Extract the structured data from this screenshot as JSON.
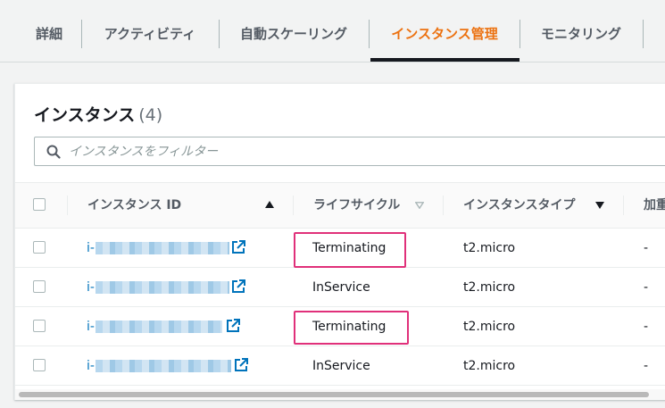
{
  "tabs": [
    {
      "label": "詳細",
      "active": false
    },
    {
      "label": "アクティビティ",
      "active": false
    },
    {
      "label": "自動スケーリング",
      "active": false
    },
    {
      "label": "インスタンス管理",
      "active": true
    },
    {
      "label": "モニタリング",
      "active": false
    }
  ],
  "colors": {
    "accent": "#ec7211",
    "link": "#0073bb",
    "highlight": "#e0307a"
  },
  "panel": {
    "title": "インスタンス",
    "count": "(4)",
    "search_placeholder": "インスタンスをフィルター"
  },
  "table": {
    "columns": [
      "インスタンス ID",
      "ライフサイクル",
      "インスタンスタイプ",
      "加重"
    ],
    "rows": [
      {
        "id_prefix": "i-",
        "lifecycle": "Terminating",
        "type": "t2.micro",
        "weight": "-",
        "highlighted": true
      },
      {
        "id_prefix": "i-",
        "lifecycle": "InService",
        "type": "t2.micro",
        "weight": "-",
        "highlighted": false
      },
      {
        "id_prefix": "i-",
        "lifecycle": "Terminating",
        "type": "t2.micro",
        "weight": "-",
        "highlighted": true
      },
      {
        "id_prefix": "i-",
        "lifecycle": "InService",
        "type": "t2.micro",
        "weight": "-",
        "highlighted": false
      }
    ]
  }
}
